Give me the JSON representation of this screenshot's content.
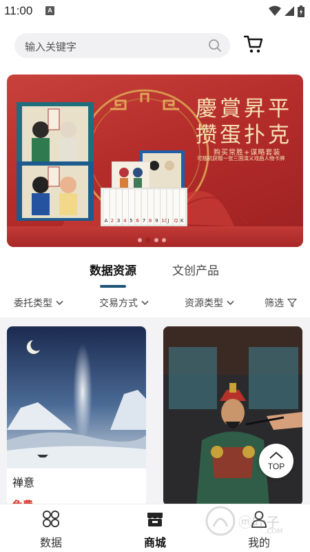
{
  "status_bar": {
    "time": "11:00",
    "notification_badge": "A"
  },
  "search": {
    "placeholder": "输入关键字"
  },
  "banner": {
    "title_line1": "慶賞昇平",
    "title_line2": "攒蛋扑克",
    "subtitle_line1": "购买常胜+谋略套装",
    "subtitle_line2": "可随机获赠一张三国演义戏曲人物卡牌",
    "card_ranks": [
      "A",
      "2",
      "3",
      "4",
      "5",
      "6",
      "7",
      "8",
      "9",
      "10",
      "J",
      "Q",
      "K"
    ],
    "slide_count": 4,
    "active_slide": 2
  },
  "tabs": [
    {
      "label": "数据资源",
      "active": true
    },
    {
      "label": "文创产品",
      "active": false
    }
  ],
  "filters": [
    {
      "label": "委托类型",
      "icon": "chevron-down-icon"
    },
    {
      "label": "交易方式",
      "icon": "chevron-down-icon"
    },
    {
      "label": "资源类型",
      "icon": "chevron-down-icon"
    },
    {
      "label": "筛选",
      "icon": "funnel-icon"
    }
  ],
  "products": [
    {
      "title": "禅意",
      "price": "免费"
    },
    {
      "title": "",
      "price": ""
    }
  ],
  "top_button": {
    "label": "TOP"
  },
  "bottom_nav": [
    {
      "label": "数据",
      "icon": "grid-clover-icon",
      "active": false
    },
    {
      "label": "商城",
      "icon": "shop-icon",
      "active": true
    },
    {
      "label": "我的",
      "icon": "user-icon",
      "active": false
    }
  ],
  "watermark": {
    "text": "ⓜ叶子",
    "sub": ".COM"
  },
  "colors": {
    "accent": "#1e5378",
    "banner_red": "#b52d2b",
    "price_red": "#d9342b",
    "banner_gold": "#f6e2b7"
  }
}
